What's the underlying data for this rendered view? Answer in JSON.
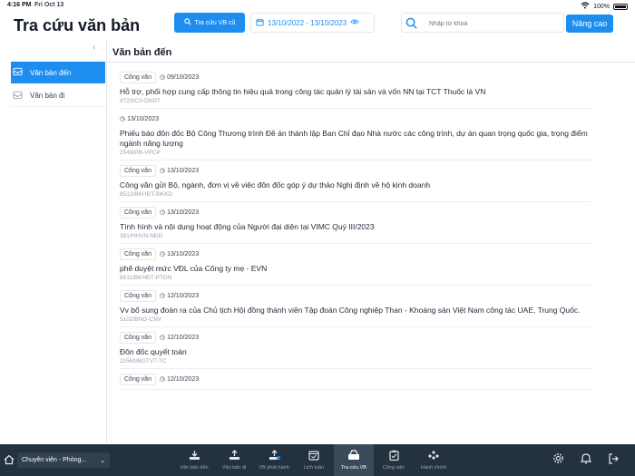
{
  "statusbar": {
    "time": "4:16 PM",
    "date": "Fri Oct 13",
    "battery": "100%"
  },
  "header": {
    "title": "Tra cứu văn bản",
    "old_search_label": "Tra cứu VB cũ",
    "date_range": "13/10/2022 - 13/10/2023",
    "search_placeholder": "Nhập từ khoá",
    "upgrade_label": "Nâng cao"
  },
  "sidebar": {
    "items": [
      {
        "label": "Văn bản đến",
        "icon": "inbox-icon",
        "active": true
      },
      {
        "label": "Văn bản đi",
        "icon": "outbox-icon",
        "active": false
      }
    ]
  },
  "main": {
    "title": "Văn bản đến",
    "items": [
      {
        "type": "Công văn",
        "date": "09/10/2023",
        "title": "Hỗ trợ, phối hợp cung cấp thông tin hiệu quả trong công tác quản lý tài sản và vốn NN tại TCT Thuốc lá VN",
        "code": "8723/CV-DNDT"
      },
      {
        "type": "",
        "date": "13/10/2023",
        "title": "Phiếu báo đôn đốc Bộ Công Thương trình Đề án thành lập Ban Chỉ đạo Nhà nước các công trình, dự án quan trọng quốc gia, trọng điểm ngành năng lượng",
        "code": "2548/PB-VPCP"
      },
      {
        "type": "Công văn",
        "date": "13/10/2023",
        "title": "Công văn gửi Bộ, ngành, đơn vị về việc đôn đốc góp ý dự thảo Nghị định về hộ kinh doanh",
        "code": "8512/BKHĐT-ĐKKD"
      },
      {
        "type": "Công văn",
        "date": "13/10/2023",
        "title": "Tình hình và nội dung hoạt động của Người đại diện tại VIMC Quý III/2023",
        "code": "391/HHVN-NĐD"
      },
      {
        "type": "Công văn",
        "date": "13/10/2023",
        "title": "phê duyệt mức VĐL của Công ty mẹ - EVN",
        "code": "8511/BKHĐT-PTDN"
      },
      {
        "type": "Công văn",
        "date": "12/10/2023",
        "title": "Vv bổ sung đoàn ra của Chủ tịch Hội đồng thành viên Tập đoàn Công nghiệp Than - Khoáng sản Việt Nam công tác UAE, Trung Quốc.",
        "code": "5102/BNG-CNV"
      },
      {
        "type": "Công văn",
        "date": "12/10/2023",
        "title": "Đôn đốc quyết toán",
        "code": "11560/BGTVT-TC"
      },
      {
        "type": "Công văn",
        "date": "12/10/2023",
        "title": "",
        "code": ""
      }
    ]
  },
  "bottombar": {
    "role": "Chuyên viên - Phòng...",
    "tabs": [
      {
        "label": "Văn bản đến",
        "icon": "inbox-tray-icon",
        "active": false
      },
      {
        "label": "Văn bản đi",
        "icon": "outbox-tray-icon",
        "active": false
      },
      {
        "label": "VB phát hành",
        "icon": "publish-icon",
        "active": false
      },
      {
        "label": "Lịch tuần",
        "icon": "calendar-icon",
        "active": false
      },
      {
        "label": "Tra cứu VB",
        "icon": "search-doc-icon",
        "active": true
      },
      {
        "label": "Công việc",
        "icon": "clipboard-icon",
        "active": false
      },
      {
        "label": "Hành chính",
        "icon": "admin-icon",
        "active": false
      }
    ]
  }
}
